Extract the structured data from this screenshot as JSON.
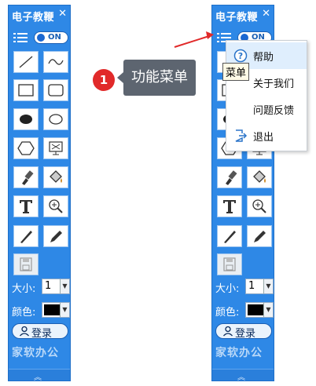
{
  "panel": {
    "title": "电子教鞭",
    "close_symbol": "✕",
    "toggle_label": "ON",
    "size_label": "大小:",
    "size_value": "1",
    "color_label": "颜色:",
    "color_value": "#000000",
    "login_label": "登录",
    "brand": "家软办公",
    "tools": [
      "line-tool",
      "curve-tool",
      "rectangle-tool",
      "rounded-rectangle-tool",
      "filled-ellipse-tool",
      "ellipse-tool",
      "hexagon-tool",
      "screen-capture-tool",
      "brush-tool",
      "fill-tool",
      "text-tool",
      "zoom-tool",
      "marker-tool",
      "pencil-tool",
      "save-tool"
    ]
  },
  "callout": {
    "number": "1",
    "text": "功能菜单"
  },
  "dropdown": {
    "items": [
      {
        "label": "帮助",
        "icon": "help-icon"
      },
      {
        "label": "关于我们",
        "icon": ""
      },
      {
        "label": "问题反馈",
        "icon": ""
      },
      {
        "label": "退出",
        "icon": "exit-icon"
      }
    ]
  },
  "tooltip": "菜单",
  "colors": {
    "panel": "#2e88e6",
    "accent_red": "#e12a2a",
    "callout_bg": "#5d6570"
  }
}
